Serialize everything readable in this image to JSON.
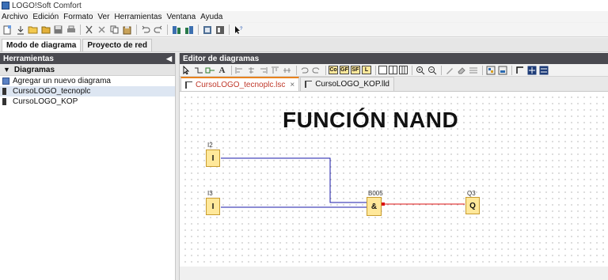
{
  "window": {
    "title": "LOGO!Soft Comfort"
  },
  "menu": [
    "Archivo",
    "Edición",
    "Formato",
    "Ver",
    "Herramientas",
    "Ventana",
    "Ayuda"
  ],
  "mode_tabs": [
    "Modo de diagrama",
    "Proyecto de red"
  ],
  "tools_panel": {
    "header": "Herramientas",
    "section": "Diagramas",
    "items": [
      "Agregar un nuevo diagrama",
      "CursoLOGO_tecnoplc",
      "CursoLOGO_KOP"
    ]
  },
  "editor": {
    "header": "Editor de diagramas",
    "toolbar_boxes": [
      "Co",
      "GF",
      "SF",
      "L"
    ],
    "tabs": [
      {
        "label": "CursoLOGO_tecnoplc.lsc",
        "close": "×"
      },
      {
        "label": "CursoLOGO_KOP.lld"
      }
    ]
  },
  "diagram": {
    "title": "FUNCIÓN NAND",
    "blocks": [
      {
        "tag": "I2",
        "symbol": "I"
      },
      {
        "tag": "I3",
        "symbol": "I"
      },
      {
        "tag": "B005",
        "symbol": "&"
      },
      {
        "tag": "Q3",
        "symbol": "Q"
      }
    ],
    "colors": {
      "input_wire": "#1a1aa8",
      "output_wire": "#d11",
      "block_fill": "#ffe89a"
    }
  }
}
